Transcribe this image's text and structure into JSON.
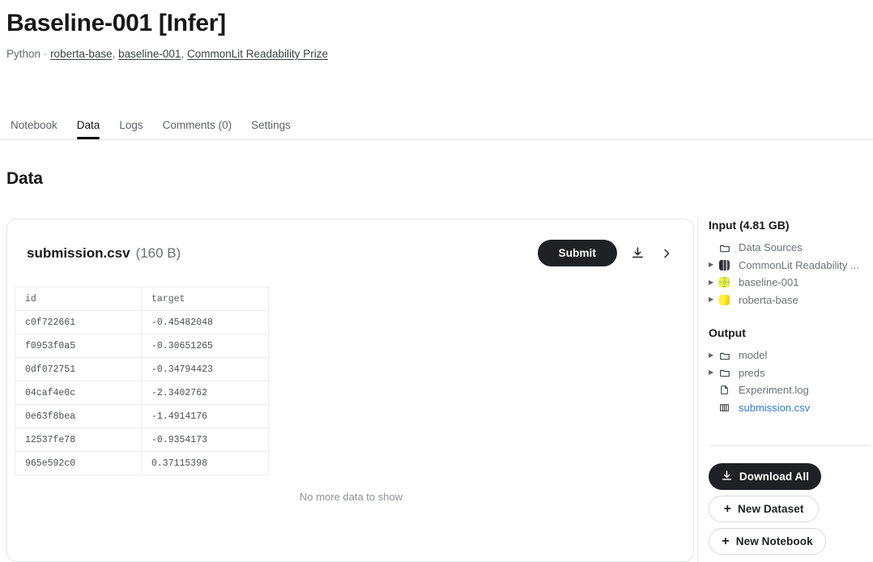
{
  "header": {
    "title": "Baseline-001 [Infer]",
    "language": "Python",
    "separator": "·",
    "links": [
      {
        "label": "roberta-base"
      },
      {
        "label": "baseline-001"
      },
      {
        "label": "CommonLit Readability Prize"
      }
    ],
    "link_separator": ", "
  },
  "tabs": [
    {
      "label": "Notebook",
      "active": false
    },
    {
      "label": "Data",
      "active": true
    },
    {
      "label": "Logs",
      "active": false
    },
    {
      "label": "Comments (0)",
      "active": false
    },
    {
      "label": "Settings",
      "active": false
    }
  ],
  "section": {
    "title": "Data"
  },
  "card": {
    "file_name": "submission.csv",
    "file_size": "(160 B)",
    "submit_label": "Submit",
    "download_icon": "download-icon",
    "expand_icon": "chevron-right-icon",
    "empty_message": "No more data to show"
  },
  "table": {
    "columns": [
      "id",
      "target"
    ],
    "rows": [
      [
        "c0f722661",
        "-0.45482048"
      ],
      [
        "f0953f0a5",
        "-0.30651265"
      ],
      [
        "0df072751",
        "-0.34794423"
      ],
      [
        "04caf4e0c",
        "-2.3402762"
      ],
      [
        "0e63f8bea",
        "-1.4914176"
      ],
      [
        "12537fe78",
        "-0.9354173"
      ],
      [
        "965e592c0",
        "0.37115398"
      ]
    ]
  },
  "sidebar": {
    "input": {
      "title": "Input (4.81 GB)",
      "items": [
        {
          "label": "Data Sources",
          "icon": "folder-icon",
          "caret": false,
          "thumb": null,
          "link": false
        },
        {
          "label": "CommonLit Readability ...",
          "icon": "dataset-thumb",
          "caret": true,
          "thumb": "commonlit",
          "link": false
        },
        {
          "label": "baseline-001",
          "icon": "dataset-thumb",
          "caret": true,
          "thumb": "baseline",
          "link": false
        },
        {
          "label": "roberta-base",
          "icon": "dataset-thumb",
          "caret": true,
          "thumb": "roberta",
          "link": false
        }
      ]
    },
    "output": {
      "title": "Output",
      "items": [
        {
          "label": "model",
          "icon": "folder-icon",
          "caret": true,
          "link": false
        },
        {
          "label": "preds",
          "icon": "folder-icon",
          "caret": true,
          "link": false
        },
        {
          "label": "Experiment.log",
          "icon": "file-icon",
          "caret": false,
          "link": false
        },
        {
          "label": "submission.csv",
          "icon": "table-file-icon",
          "caret": false,
          "link": true
        }
      ]
    },
    "buttons": [
      {
        "label": "Download All",
        "style": "dark",
        "icon": "download-icon"
      },
      {
        "label": "New Dataset",
        "style": "ghost",
        "icon": "plus-icon"
      },
      {
        "label": "New Notebook",
        "style": "ghost",
        "icon": "plus-icon"
      }
    ]
  },
  "colors": {
    "accent_dark": "#202124",
    "link_blue": "#2b7ddb",
    "muted": "#6d7175"
  }
}
